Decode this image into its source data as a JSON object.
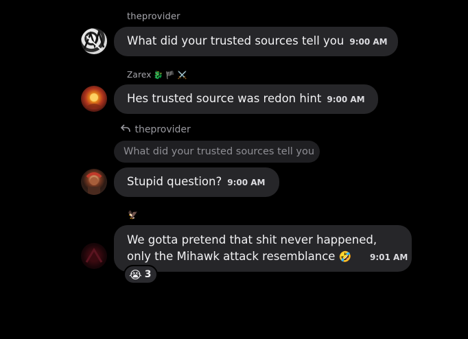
{
  "messages": [
    {
      "username": "theprovider",
      "text": "What did your trusted sources tell you",
      "time": "9:00 AM"
    },
    {
      "username": "Zarex",
      "badges": "🐉 🏴 ⚔️",
      "text": "Hes trusted source was redon hint",
      "time": "9:00 AM"
    },
    {
      "reply_to": "theprovider",
      "quoted_text": "What did your trusted sources tell you",
      "text": "Stupid question?",
      "time": "9:00 AM"
    },
    {
      "username_badge": "🦅",
      "line1": "We gotta pretend that shit never happened,",
      "line2": "only the Mihawk attack resemblance",
      "emoji": "🤣",
      "time": "9:01 AM",
      "reaction": {
        "emoji": "😭",
        "count": "3"
      }
    }
  ],
  "colors": {
    "background": "#000000",
    "bubble": "#262629",
    "quoted_bubble": "#1f1f22",
    "username": "#a8a8ae"
  }
}
